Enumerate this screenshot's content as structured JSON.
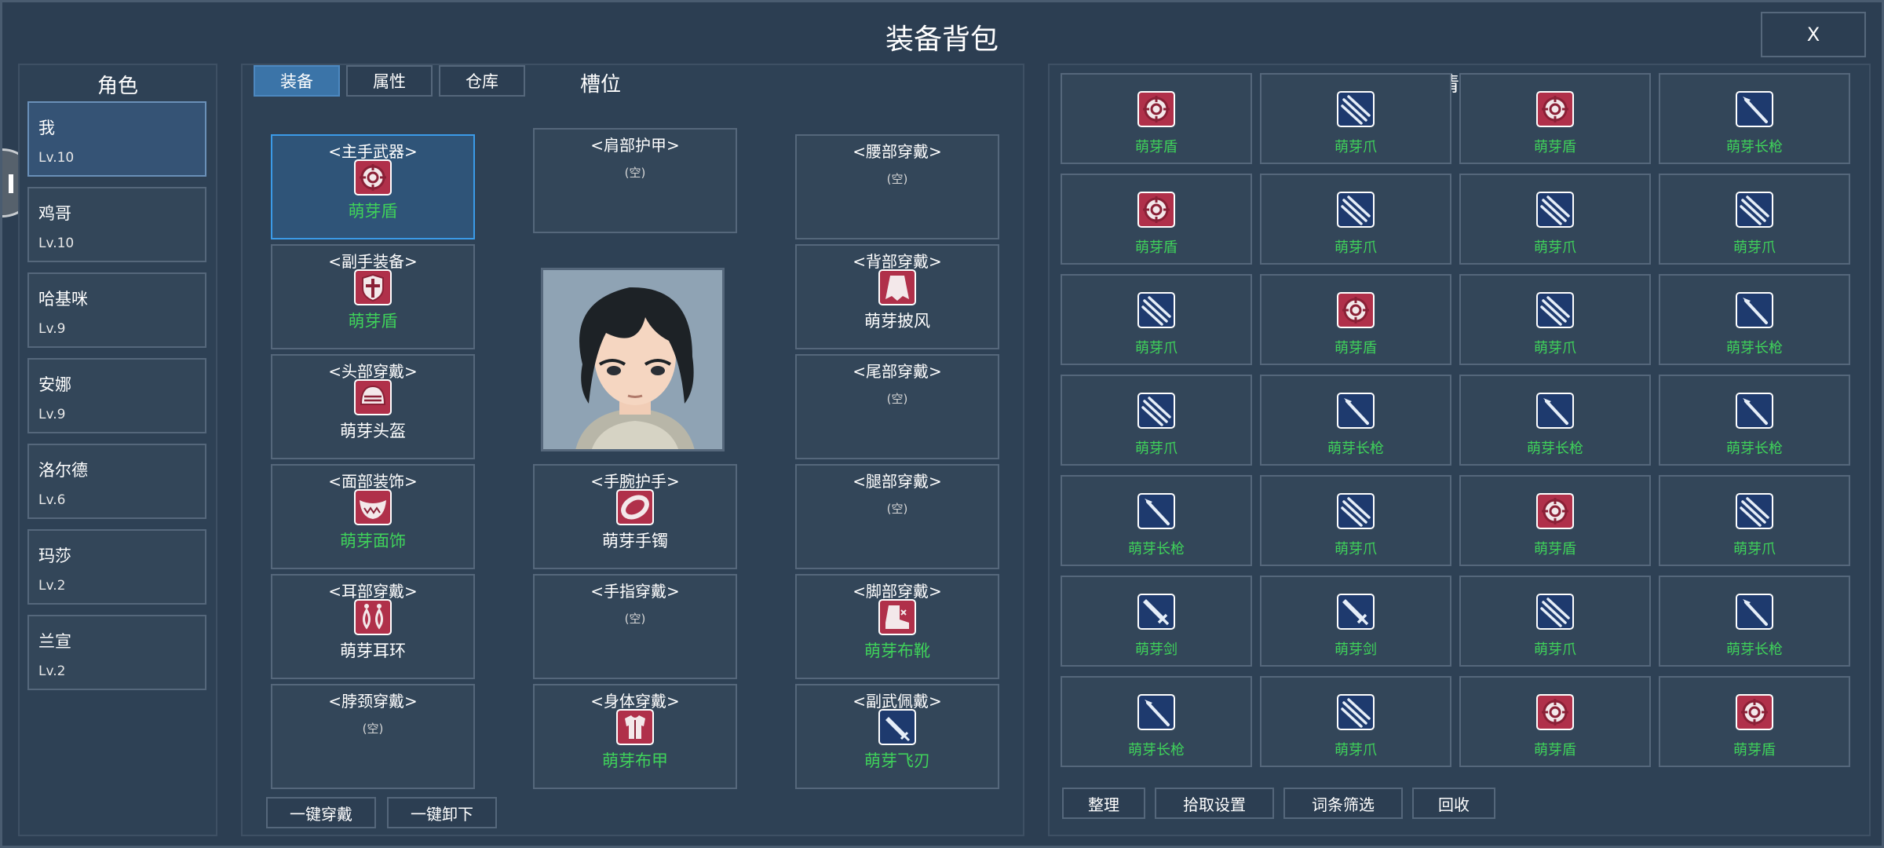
{
  "title": "装备背包",
  "close_label": "X",
  "characters_title": "角色",
  "characters": [
    {
      "name": "我",
      "level": "Lv.10"
    },
    {
      "name": "鸡哥",
      "level": "Lv.10"
    },
    {
      "name": "哈基咪",
      "level": "Lv.9"
    },
    {
      "name": "安娜",
      "level": "Lv.9"
    },
    {
      "name": "洛尔德",
      "level": "Lv.6"
    },
    {
      "name": "玛莎",
      "level": "Lv.2"
    },
    {
      "name": "兰宣",
      "level": "Lv.2"
    }
  ],
  "tabs": [
    "装备",
    "属性",
    "仓库"
  ],
  "slots_title": "槽位",
  "slots": {
    "main_weapon": {
      "label": "<主手武器>",
      "item": "萌芽盾",
      "icon": "shield-target-icon"
    },
    "off_hand": {
      "label": "<副手装备>",
      "item": "萌芽盾",
      "icon": "cross-shield-icon"
    },
    "head": {
      "label": "<头部穿戴>",
      "item": "萌芽头盔",
      "icon": "helmet-icon"
    },
    "face": {
      "label": "<面部装饰>",
      "item": "萌芽面饰",
      "icon": "face-mask-icon"
    },
    "ear": {
      "label": "<耳部穿戴>",
      "item": "萌芽耳环",
      "icon": "earring-icon"
    },
    "neck": {
      "label": "<脖颈穿戴>",
      "empty": "(空)"
    },
    "shoulder": {
      "label": "<肩部护甲>",
      "empty": "(空)"
    },
    "wrist": {
      "label": "<手腕护手>",
      "item": "萌芽手镯",
      "icon": "bracelet-icon"
    },
    "finger": {
      "label": "<手指穿戴>",
      "empty": "(空)"
    },
    "body": {
      "label": "<身体穿戴>",
      "item": "萌芽布甲",
      "icon": "cloth-armor-icon"
    },
    "waist": {
      "label": "<腰部穿戴>",
      "empty": "(空)"
    },
    "back": {
      "label": "<背部穿戴>",
      "item": "萌芽披风",
      "icon": "cape-icon"
    },
    "tail": {
      "label": "<尾部穿戴>",
      "empty": "(空)"
    },
    "leg": {
      "label": "<腿部穿戴>",
      "empty": "(空)"
    },
    "foot": {
      "label": "<脚部穿戴>",
      "item": "萌芽布靴",
      "icon": "boot-icon"
    },
    "sub_weapon": {
      "label": "<副武佩戴>",
      "item": "萌芽飞刃",
      "icon": "throwing-blade-icon"
    }
  },
  "actions": {
    "equip_all": "一键穿戴",
    "unequip_all": "一键卸下"
  },
  "inventory_title": "清单",
  "inventory": [
    {
      "name": "萌芽盾",
      "icon": "shield-target-icon"
    },
    {
      "name": "萌芽爪",
      "icon": "claw-icon"
    },
    {
      "name": "萌芽盾",
      "icon": "shield-target-icon"
    },
    {
      "name": "萌芽长枪",
      "icon": "spear-icon"
    },
    {
      "name": "萌芽盾",
      "icon": "shield-target-icon"
    },
    {
      "name": "萌芽爪",
      "icon": "claw-icon"
    },
    {
      "name": "萌芽爪",
      "icon": "claw-icon"
    },
    {
      "name": "萌芽爪",
      "icon": "claw-icon"
    },
    {
      "name": "萌芽爪",
      "icon": "claw-icon"
    },
    {
      "name": "萌芽盾",
      "icon": "shield-target-icon"
    },
    {
      "name": "萌芽爪",
      "icon": "claw-icon"
    },
    {
      "name": "萌芽长枪",
      "icon": "spear-icon"
    },
    {
      "name": "萌芽爪",
      "icon": "claw-icon"
    },
    {
      "name": "萌芽长枪",
      "icon": "spear-icon"
    },
    {
      "name": "萌芽长枪",
      "icon": "spear-icon"
    },
    {
      "name": "萌芽长枪",
      "icon": "spear-icon"
    },
    {
      "name": "萌芽长枪",
      "icon": "spear-icon"
    },
    {
      "name": "萌芽爪",
      "icon": "claw-icon"
    },
    {
      "name": "萌芽盾",
      "icon": "shield-target-icon"
    },
    {
      "name": "萌芽爪",
      "icon": "claw-icon"
    },
    {
      "name": "萌芽剑",
      "icon": "sword-icon"
    },
    {
      "name": "萌芽剑",
      "icon": "sword-icon"
    },
    {
      "name": "萌芽爪",
      "icon": "claw-icon"
    },
    {
      "name": "萌芽长枪",
      "icon": "spear-icon"
    },
    {
      "name": "萌芽长枪",
      "icon": "spear-icon"
    },
    {
      "name": "萌芽爪",
      "icon": "claw-icon"
    },
    {
      "name": "萌芽盾",
      "icon": "shield-target-icon"
    },
    {
      "name": "萌芽盾",
      "icon": "shield-target-icon"
    }
  ],
  "inventory_actions": [
    "整理",
    "拾取设置",
    "词条筛选",
    "回收"
  ],
  "colors": {
    "accent": "#3b74a8",
    "item_green": "#3fd25a",
    "panel": "#2e4155",
    "red_icon": "#b0304a",
    "blue_icon": "#1e3a6e"
  }
}
